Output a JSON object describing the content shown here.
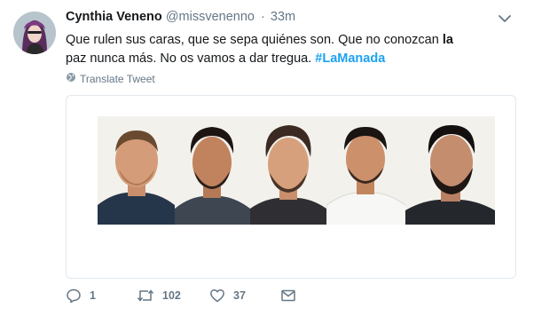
{
  "tweet": {
    "display_name": "Cynthia Veneno",
    "handle": "@missvenenno",
    "separator": "·",
    "time": "33m",
    "text_part1": "Que rulen sus caras, que se sepa quiénes son. Que no conozcan ",
    "text_bold": "la",
    "text_part2": " paz nunca más. No os vamos a dar tregua. ",
    "hashtag": "#LaManada",
    "translate_label": "Translate Tweet"
  },
  "actions": {
    "reply_count": "1",
    "retweet_count": "102",
    "like_count": "37"
  },
  "icons": {
    "avatar": "avatar",
    "caret": "chevron-down-icon",
    "translate": "globe-icon",
    "reply": "reply-icon",
    "retweet": "retweet-icon",
    "like": "heart-icon",
    "dm": "envelope-icon"
  },
  "colors": {
    "link": "#1da1f2",
    "muted": "#657786",
    "text": "#14171a",
    "border": "#e1e8ed"
  }
}
